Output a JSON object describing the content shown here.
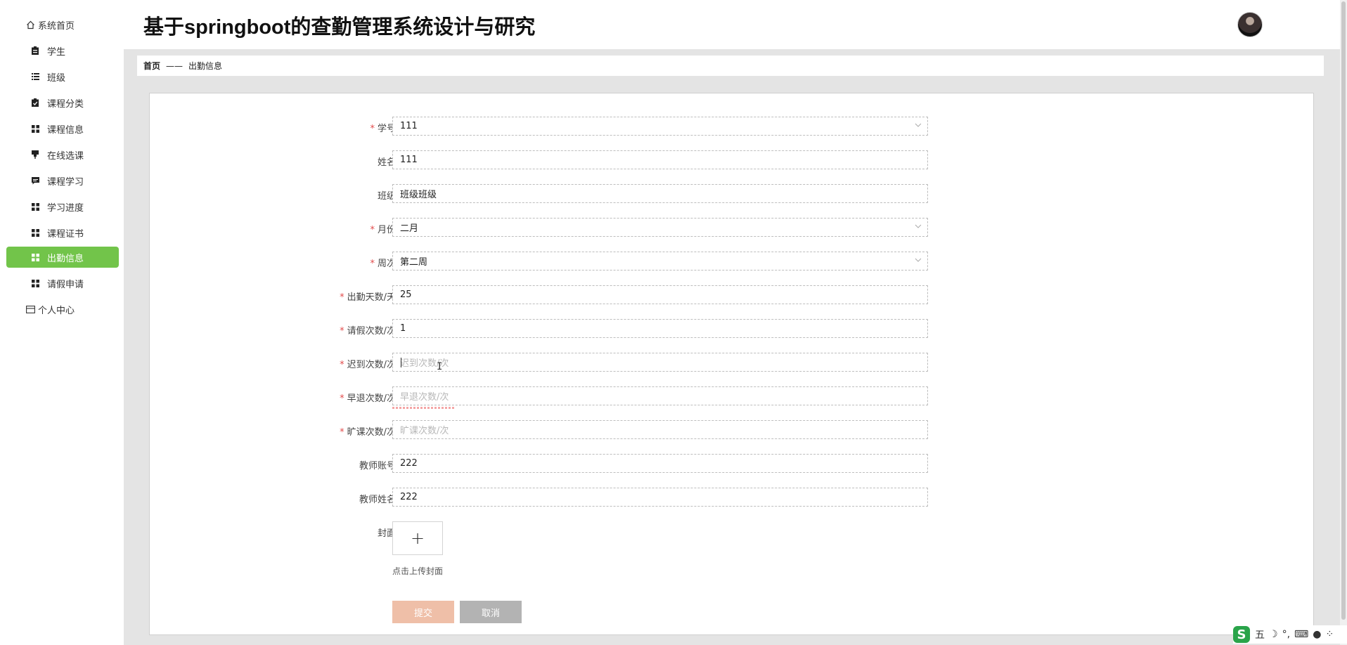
{
  "app": {
    "title": "基于springboot的查勤管理系统设计与研究"
  },
  "sidebar": {
    "items": [
      {
        "label": "系统首页",
        "icon": "home-icon"
      },
      {
        "label": "学生",
        "icon": "clipboard-icon"
      },
      {
        "label": "班级",
        "icon": "list-icon"
      },
      {
        "label": "课程分类",
        "icon": "check-clipboard-icon"
      },
      {
        "label": "课程信息",
        "icon": "grid-icon"
      },
      {
        "label": "在线选课",
        "icon": "pin-icon"
      },
      {
        "label": "课程学习",
        "icon": "chat-icon"
      },
      {
        "label": "学习进度",
        "icon": "grid-icon"
      },
      {
        "label": "课程证书",
        "icon": "grid-icon"
      },
      {
        "label": "出勤信息",
        "icon": "grid-icon",
        "active": true
      },
      {
        "label": "请假申请",
        "icon": "grid-icon"
      },
      {
        "label": "个人中心",
        "icon": "card-icon"
      }
    ],
    "active_color": "#72c44a"
  },
  "breadcrumb": {
    "home": "首页",
    "separator": "——",
    "current": "出勤信息"
  },
  "form": {
    "student_no": {
      "label": "学号",
      "value": "111",
      "required": true
    },
    "name": {
      "label": "姓名",
      "value": "111"
    },
    "class": {
      "label": "班级",
      "value": "班级班级"
    },
    "month": {
      "label": "月份",
      "value": "二月",
      "required": true
    },
    "week": {
      "label": "周次",
      "value": "第二周",
      "required": true
    },
    "attendance_days": {
      "label": "出勤天数/天",
      "value": "25",
      "required": true
    },
    "leave_count": {
      "label": "请假次数/次",
      "value": "1",
      "required": true
    },
    "late_count": {
      "label": "迟到次数/次",
      "placeholder": "迟到次数/次",
      "required": true
    },
    "early_leave_count": {
      "label": "早退次数/次",
      "placeholder": "早退次数/次",
      "required": true
    },
    "absent_count": {
      "label": "旷课次数/次",
      "placeholder": "旷课次数/次",
      "required": true
    },
    "teacher_account": {
      "label": "教师账号",
      "value": "222"
    },
    "teacher_name": {
      "label": "教师姓名",
      "value": "222"
    },
    "cover": {
      "label": "封面",
      "plus": "+",
      "tip": "点击上传封面"
    },
    "submit_label": "提交",
    "cancel_label": "取消",
    "required_mark": "*"
  },
  "ime": {
    "logo": "S",
    "mode": "五",
    "moon": "☽",
    "punct": "°,",
    "keyboard": "⌨",
    "user": "●",
    "apps": "⁘"
  }
}
